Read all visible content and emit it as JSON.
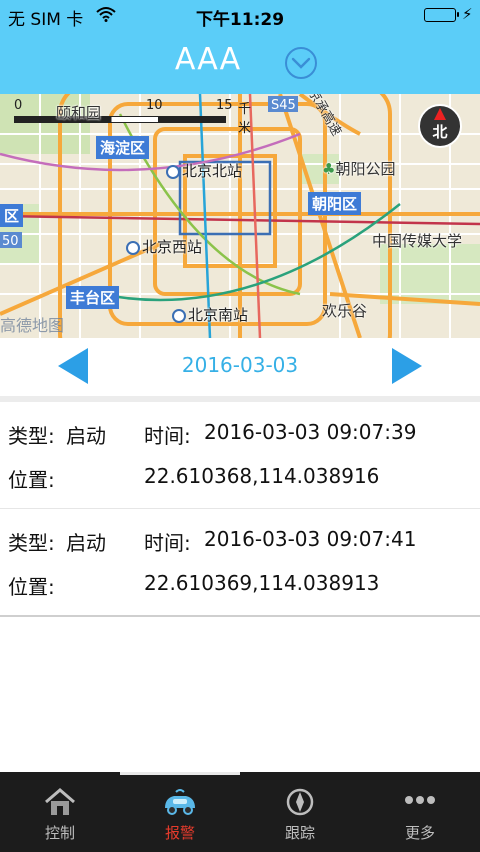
{
  "status_bar": {
    "carrier": "无 SIM 卡",
    "time": "下午11:29"
  },
  "header": {
    "title": "AAA",
    "dropdown_icon": "chevron-down-circle-icon"
  },
  "map": {
    "scale": {
      "t0": "0",
      "t1": "10",
      "t2": "15",
      "unit": "千米"
    },
    "compass": "北",
    "watermark": "高德地图",
    "road_badges": [
      "S45",
      "50"
    ],
    "labels": {
      "yiheyuan": "颐和园",
      "highway": "京承高速",
      "haidian": "海淀区",
      "beijing_north": "北京北站",
      "chaoyang_park": "朝阳公园",
      "chaoyang": "朝阳区",
      "left_district": "区",
      "beijing_west": "北京西站",
      "media_university": "中国传媒大学",
      "fengtai": "丰台区",
      "huanlegu": "欢乐谷",
      "beijing_south": "北京南站"
    }
  },
  "pager": {
    "date": "2016-03-03",
    "prev_icon": "triangle-left-icon",
    "next_icon": "triangle-right-icon"
  },
  "records": [
    {
      "type_label": "类型:",
      "type_value": "启动",
      "time_label": "时间:",
      "time_value": "2016-03-03 09:07:39",
      "position_label": "位置:",
      "position_value": "22.610368,114.038916"
    },
    {
      "type_label": "类型:",
      "type_value": "启动",
      "time_label": "时间:",
      "time_value": "2016-03-03 09:07:41",
      "position_label": "位置:",
      "position_value": "22.610369,114.038913"
    }
  ],
  "tabbar": {
    "items": [
      {
        "label": "控制",
        "icon": "home-icon"
      },
      {
        "label": "报警",
        "icon": "car-alarm-icon"
      },
      {
        "label": "跟踪",
        "icon": "compass-icon"
      },
      {
        "label": "更多",
        "icon": "more-dots-icon"
      }
    ],
    "active_index": 1,
    "active_color": "#e53b2c"
  },
  "colors": {
    "header": "#5bcdf8",
    "accent": "#36b0e6",
    "district": "#3e7bd6"
  }
}
